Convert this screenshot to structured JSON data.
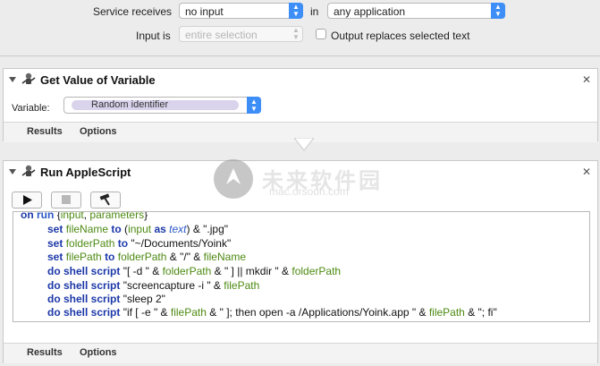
{
  "service_bar": {
    "service_receives_label": "Service receives",
    "service_receives_value": "no input",
    "in_label": "in",
    "in_value": "any application",
    "input_is_label": "Input is",
    "input_is_value": "entire selection",
    "output_replaces_label": "Output replaces selected text",
    "output_replaces_checked": false
  },
  "actions": [
    {
      "title": "Get Value of Variable",
      "variable_label": "Variable:",
      "variable_value": "Random identifier",
      "tabs": [
        "Results",
        "Options"
      ]
    },
    {
      "title": "Run AppleScript",
      "code_lines": [
        "on run {input, parameters}",
        "set fileName to (input as text) & \".jpg\"",
        "set folderPath to \"~/Documents/Yoink\"",
        "set filePath to folderPath & \"/\" & fileName",
        "do shell script \"[ -d \" & folderPath & \" ] || mkdir \" & folderPath",
        "do shell script \"screencapture -i \" & filePath",
        "do shell script \"sleep 2\"",
        "do shell script \"if [ -e \" & filePath & \" ]; then open -a /Applications/Yoink.app \" & filePath & \"; fi\""
      ],
      "tabs": [
        "Results",
        "Options"
      ]
    }
  ],
  "watermark": {
    "title": "未来软件园",
    "subtitle": "mac.orsoon.com"
  },
  "colors": {
    "accent": "#3d8ff7",
    "keyword": "#1c38a8",
    "variable": "#4d8a12",
    "token": "#d9d3ec"
  },
  "icons": [
    "disclosure-triangle-icon",
    "automator-robot-icon",
    "close-icon",
    "play-icon",
    "stop-icon",
    "hammer-icon",
    "popup-arrows-icon"
  ]
}
